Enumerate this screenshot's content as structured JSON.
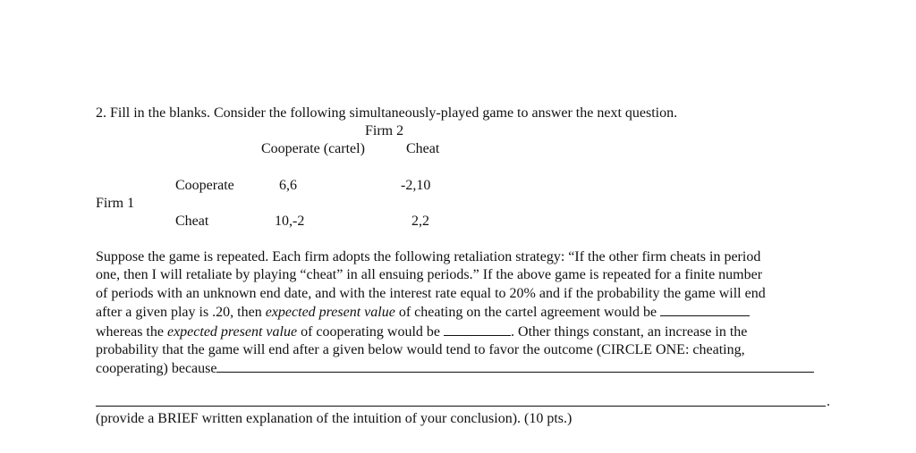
{
  "question": {
    "title": "2. Fill in the blanks. Consider the following simultaneously-played game to answer the next question.",
    "game": {
      "column_player": "Firm 2",
      "column_strategies": [
        "Cooperate (cartel)",
        "Cheat"
      ],
      "row_player": "Firm 1",
      "row_strategies": [
        "Cooperate",
        "Cheat"
      ],
      "payoffs": [
        [
          "6,6",
          "-2,10"
        ],
        [
          "10,-2",
          "2,2"
        ]
      ]
    },
    "paragraph": {
      "l1": "Suppose the game is repeated. Each firm adopts the following retaliation strategy: “If the other firm cheats in period",
      "l2": "one, then I will retaliate by playing “cheat” in all ensuing periods.” If the above game is repeated for a finite number",
      "l3": "of periods with an unknown end date, and with the interest rate equal to 20% and if the probability the game will end",
      "l4a": "after a given play is .20, then ",
      "l4b": "expected present value",
      "l4c": " of  cheating on the cartel agreement would be ",
      "l5a": "whereas the ",
      "l5b": "expected present value",
      "l5c": " of cooperating would be ",
      "l5d": ". Other things constant, an increase in the",
      "l6": "probability that the game will end after a given below would tend to favor the outcome (CIRCLE ONE: cheating,",
      "l7": "cooperating) because"
    },
    "period_mark": ".",
    "footer": "(provide a BRIEF written explanation of the intuition of your conclusion). (10 pts.)"
  }
}
